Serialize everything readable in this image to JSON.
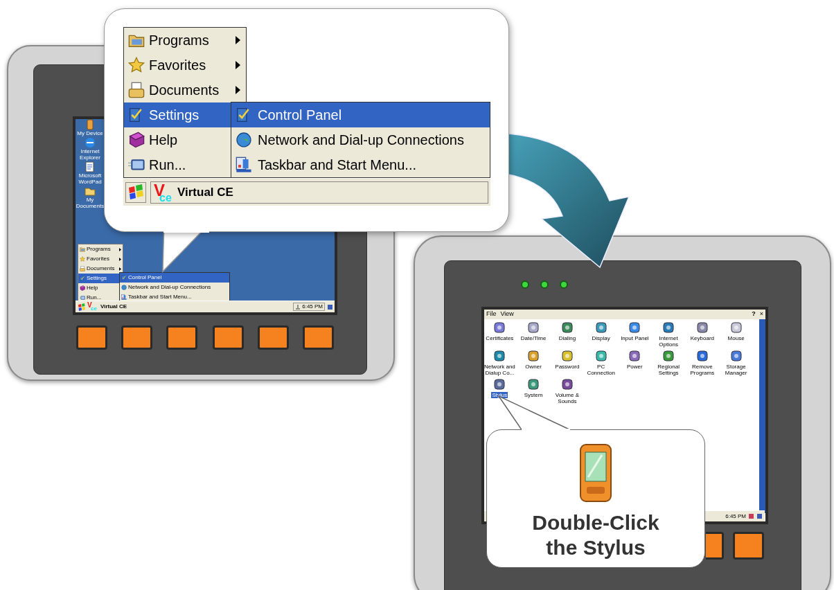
{
  "left_device": {
    "desktop_icons": [
      {
        "label": "My Device"
      },
      {
        "label": "Internet Explorer"
      },
      {
        "label": "Microsoft WordPad"
      },
      {
        "label": "My Documents"
      }
    ],
    "start_menu": [
      {
        "label": "Programs",
        "submenu": true,
        "selected": false
      },
      {
        "label": "Favorites",
        "submenu": true,
        "selected": false
      },
      {
        "label": "Documents",
        "submenu": true,
        "selected": false
      },
      {
        "label": "Settings",
        "submenu": false,
        "selected": true
      },
      {
        "label": "Help",
        "submenu": false,
        "selected": false
      },
      {
        "label": "Run...",
        "submenu": false,
        "selected": false
      }
    ],
    "settings_menu": [
      {
        "label": "Control Panel",
        "selected": true
      },
      {
        "label": "Network and Dial-up Connections",
        "selected": false
      },
      {
        "label": "Taskbar and Start Menu...",
        "selected": false
      }
    ],
    "taskbar": {
      "logo": "V",
      "logo_sub": "ce",
      "task": "Virtual CE",
      "clock": "6:45 PM"
    }
  },
  "zoom_callout": {
    "start_menu": [
      {
        "label": "Programs",
        "submenu": true,
        "selected": false
      },
      {
        "label": "Favorites",
        "submenu": true,
        "selected": false
      },
      {
        "label": "Documents",
        "submenu": true,
        "selected": false
      },
      {
        "label": "Settings",
        "submenu": false,
        "selected": true
      },
      {
        "label": "Help",
        "submenu": false,
        "selected": false
      },
      {
        "label": "Run...",
        "submenu": false,
        "selected": false
      }
    ],
    "settings_menu": [
      {
        "label": "Control Panel",
        "selected": true
      },
      {
        "label": "Network and Dial-up Connections",
        "selected": false
      },
      {
        "label": "Taskbar and Start Menu...",
        "selected": false
      }
    ],
    "taskbar": {
      "logo": "V",
      "logo_sub": "ce",
      "task": "Virtual CE"
    }
  },
  "right_device": {
    "menu_bar": [
      "File",
      "View"
    ],
    "help_button": "?",
    "close_button": "×",
    "applets": [
      {
        "label": "Certificates",
        "selected": false
      },
      {
        "label": "Date/Time",
        "selected": false
      },
      {
        "label": "Dialing",
        "selected": false
      },
      {
        "label": "Display",
        "selected": false
      },
      {
        "label": "Input Panel",
        "selected": false
      },
      {
        "label": "Internet Options",
        "selected": false
      },
      {
        "label": "Keyboard",
        "selected": false
      },
      {
        "label": "Mouse",
        "selected": false
      },
      {
        "label": "Network and Dialup Co...",
        "selected": false
      },
      {
        "label": "Owner",
        "selected": false
      },
      {
        "label": "Password",
        "selected": false
      },
      {
        "label": "PC Connection",
        "selected": false
      },
      {
        "label": "Power",
        "selected": false
      },
      {
        "label": "Regional Settings",
        "selected": false
      },
      {
        "label": "Remove Programs",
        "selected": false
      },
      {
        "label": "Storage Manager",
        "selected": false
      },
      {
        "label": "Stylus",
        "selected": true
      },
      {
        "label": "System",
        "selected": false
      },
      {
        "label": "Volume & Sounds",
        "selected": false
      }
    ],
    "clock": "6:45 PM"
  },
  "stylus_callout": {
    "caption": "Double-Click the Stylus"
  }
}
